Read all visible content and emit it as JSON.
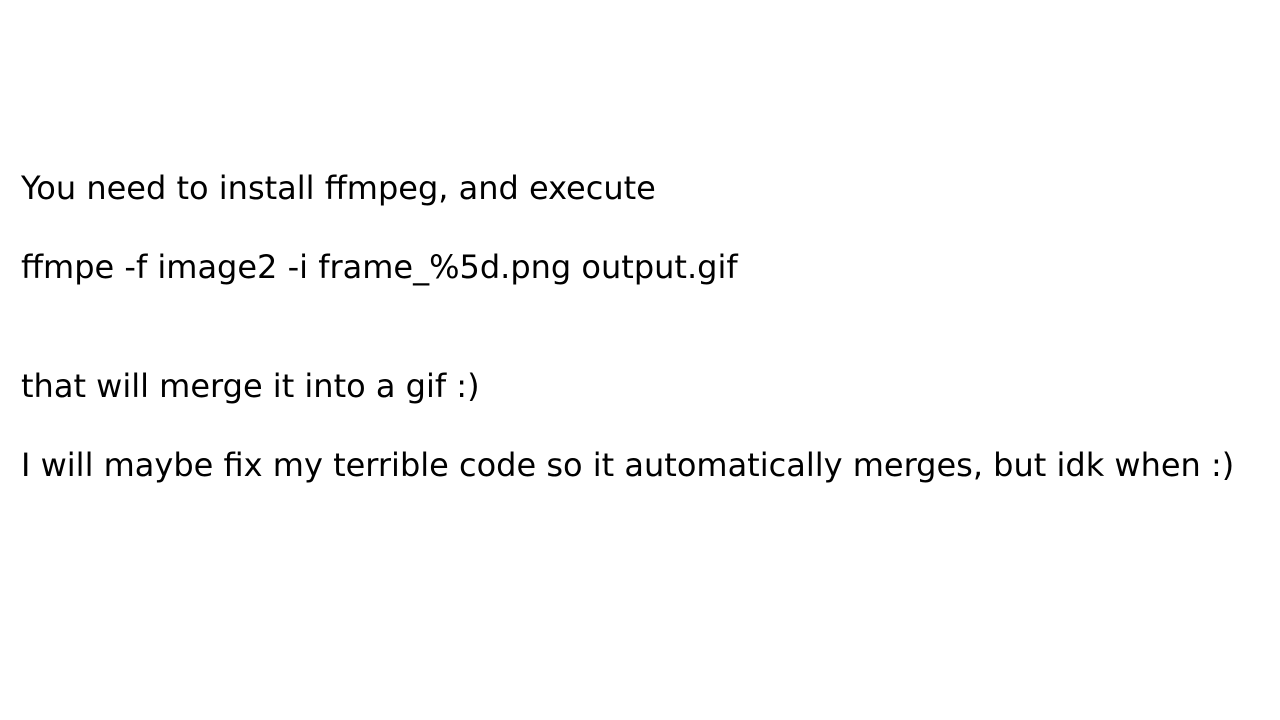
{
  "lines": [
    "You need to install ffmpeg, and execute",
    "ffmpe -f image2 -i frame_%5d.png output.gif",
    "that will merge it into a gif :)",
    "I will maybe fix my terrible code so it automatically merges, but idk when :)"
  ]
}
